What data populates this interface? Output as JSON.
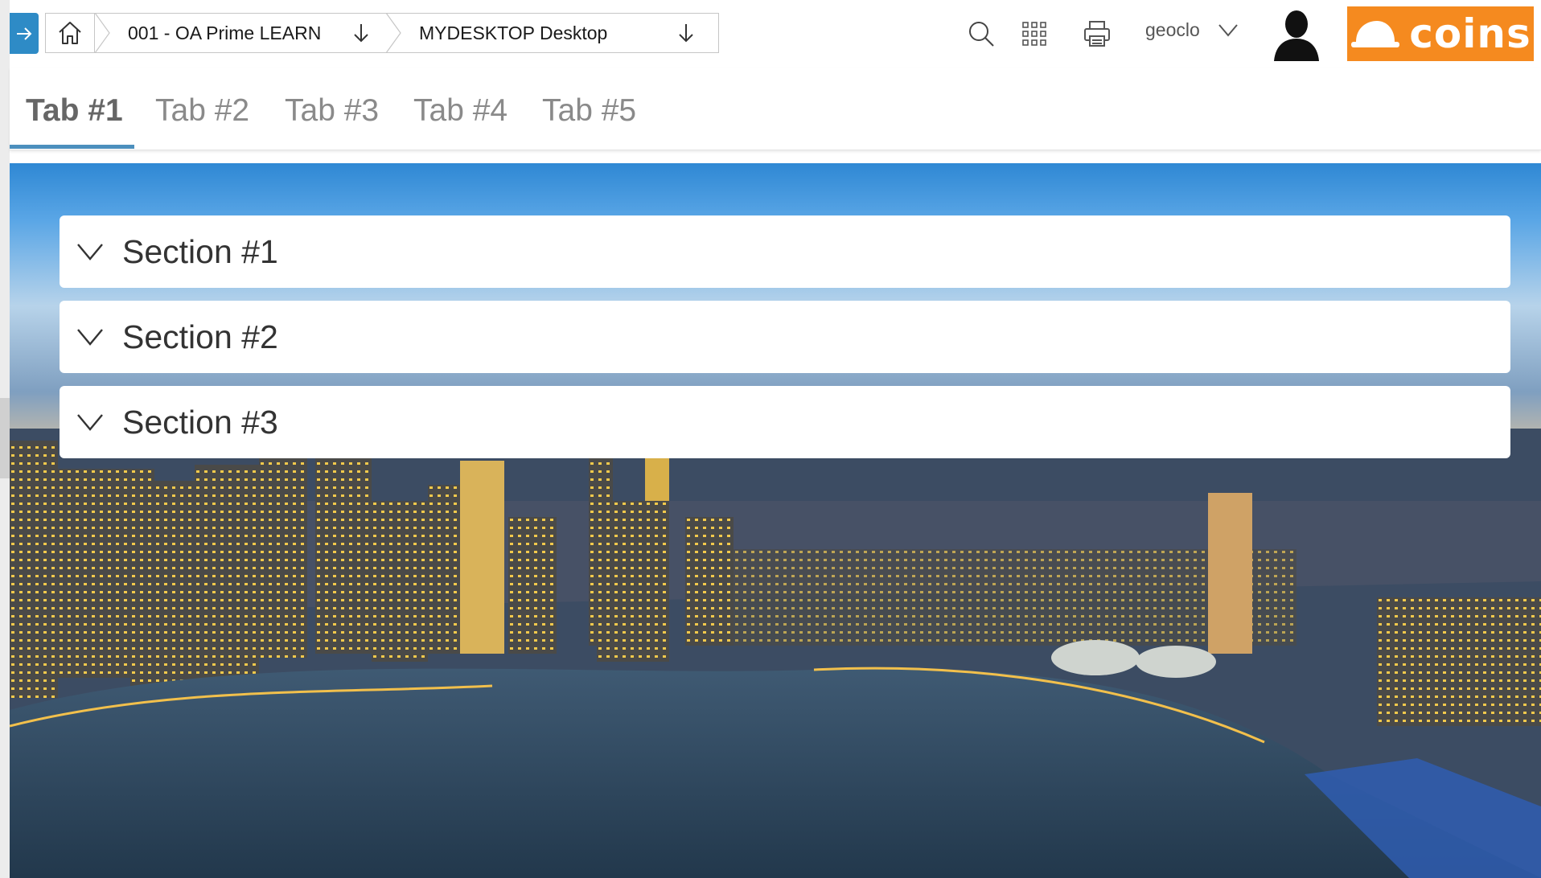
{
  "header": {
    "home_icon": "home-icon",
    "company_selector": {
      "label": "001 - OA Prime LEARN",
      "icon": "arrow-down-icon"
    },
    "desktop_selector": {
      "label": "MYDESKTOP Desktop",
      "icon": "arrow-down-icon"
    },
    "search_icon": "search-icon",
    "apps_icon": "grid-icon",
    "print_icon": "printer-icon",
    "user": {
      "name": "geoclo",
      "menu_icon": "chevron-down-icon"
    },
    "avatar_icon": "user-silhouette-icon",
    "logo": {
      "text": "coins",
      "icon": "hard-hat-icon"
    },
    "colors": {
      "accent": "#2e8bc6",
      "logo_bg": "#f58a1f",
      "tab_underline": "#4c8fbd"
    }
  },
  "nav_toggle_icon": "arrow-right-icon",
  "tabs": [
    {
      "label": "Tab #1",
      "active": true
    },
    {
      "label": "Tab #2",
      "active": false
    },
    {
      "label": "Tab #3",
      "active": false
    },
    {
      "label": "Tab #4",
      "active": false
    },
    {
      "label": "Tab #5",
      "active": false
    }
  ],
  "sections": [
    {
      "label": "Section #1",
      "icon": "chevron-down-icon"
    },
    {
      "label": "Section #2",
      "icon": "chevron-down-icon"
    },
    {
      "label": "Section #3",
      "icon": "chevron-down-icon"
    }
  ]
}
